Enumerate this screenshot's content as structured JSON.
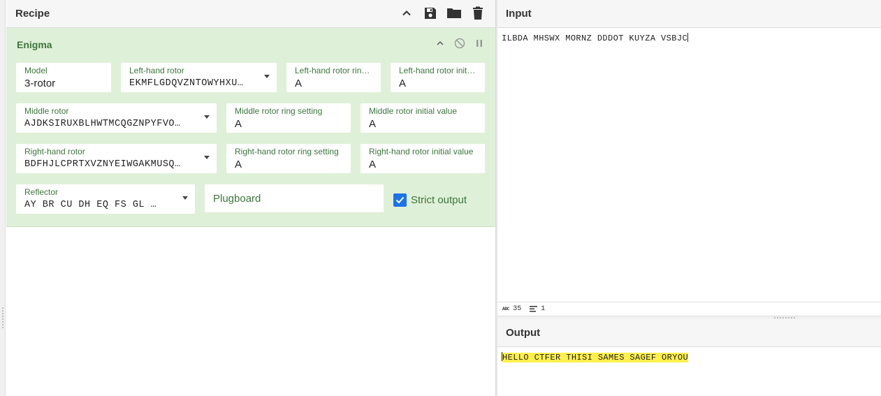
{
  "recipe": {
    "title": "Recipe",
    "actions": [
      "chevron-up-icon",
      "save-icon",
      "folder-icon",
      "trash-icon"
    ]
  },
  "operation": {
    "name": "Enigma",
    "model": {
      "label": "Model",
      "value": "3-rotor"
    },
    "left_rotor": {
      "label": "Left-hand rotor",
      "value": "EKMFLGDQVZNTOWYHXU…"
    },
    "left_ring": {
      "label": "Left-hand rotor ring …",
      "value": "A"
    },
    "left_initial": {
      "label": "Left-hand rotor initial…",
      "value": "A"
    },
    "middle_rotor": {
      "label": "Middle rotor",
      "value": "AJDKSIRUXBLHWTMCQGZNPYFVO…"
    },
    "middle_ring": {
      "label": "Middle rotor ring setting",
      "value": "A"
    },
    "middle_initial": {
      "label": "Middle rotor initial value",
      "value": "A"
    },
    "right_rotor": {
      "label": "Right-hand rotor",
      "value": "BDFHJLCPRTXVZNYEIWGAKMUSQ…"
    },
    "right_ring": {
      "label": "Right-hand rotor ring setting",
      "value": "A"
    },
    "right_initial": {
      "label": "Right-hand rotor initial value",
      "value": "A"
    },
    "reflector": {
      "label": "Reflector",
      "value": "AY BR CU DH EQ FS GL …"
    },
    "plugboard": {
      "placeholder": "Plugboard"
    },
    "strict_output": {
      "label": "Strict output",
      "checked": true
    }
  },
  "input": {
    "title": "Input",
    "text": "ILBDA MHSWX MORNZ DDDOT KUYZA VSBJC",
    "status": {
      "length": "35",
      "lines": "1"
    }
  },
  "output": {
    "title": "Output",
    "text": "HELLO CTFER THISI SAMES SAGEF ORYOU",
    "highlight_color": "#fff04d"
  },
  "colors": {
    "operation_bg": "#dff0d8",
    "label_green": "#3c763d",
    "checkbox_blue": "#1a73e8"
  }
}
